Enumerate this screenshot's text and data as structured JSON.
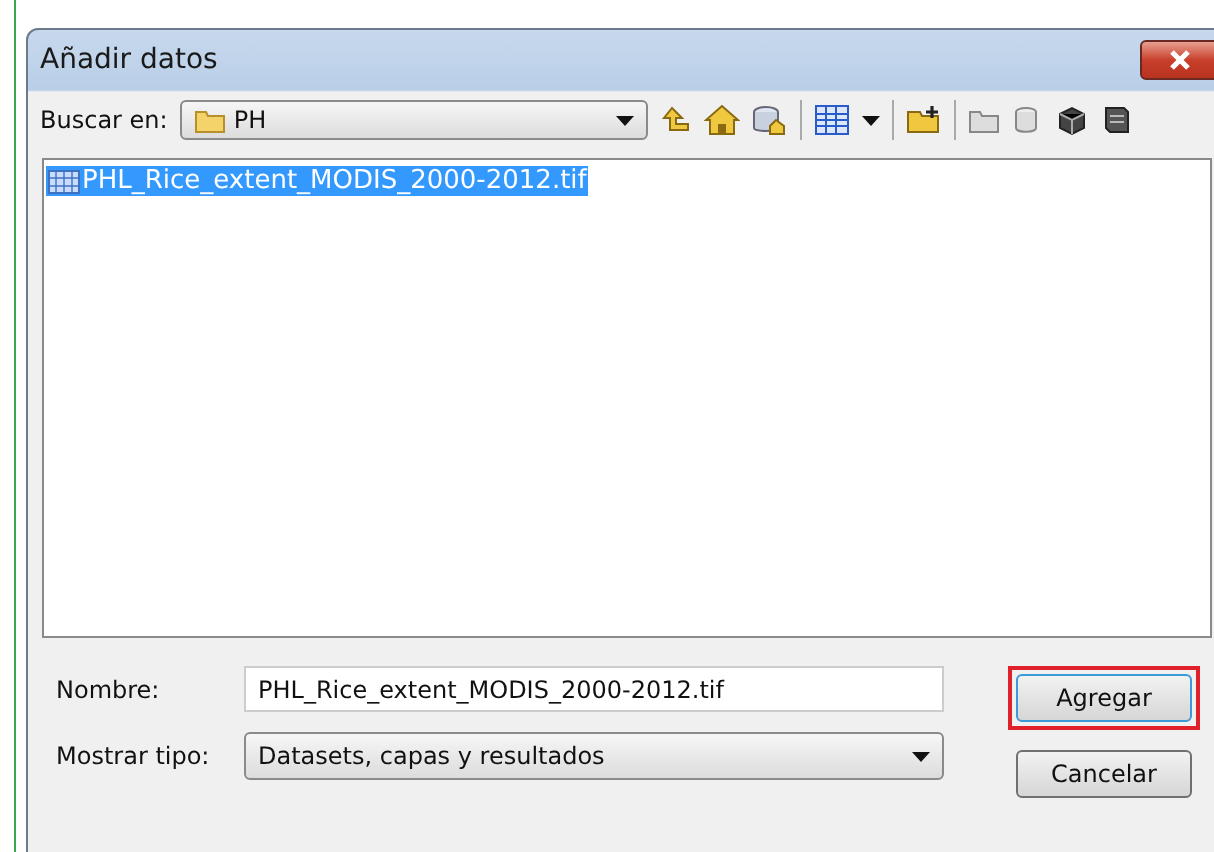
{
  "window": {
    "title": "Añadir datos"
  },
  "location": {
    "label": "Buscar en:",
    "value": "PH"
  },
  "files": [
    {
      "name": "PHL_Rice_extent_MODIS_2000-2012.tif",
      "selected": true
    }
  ],
  "name_field": {
    "label": "Nombre:",
    "value": "PHL_Rice_extent_MODIS_2000-2012.tif"
  },
  "type_field": {
    "label": "Mostrar tipo:",
    "value": "Datasets, capas y resultados"
  },
  "buttons": [
    {
      "label": "Agregar",
      "highlighted": true
    },
    {
      "label": "Cancelar"
    }
  ]
}
